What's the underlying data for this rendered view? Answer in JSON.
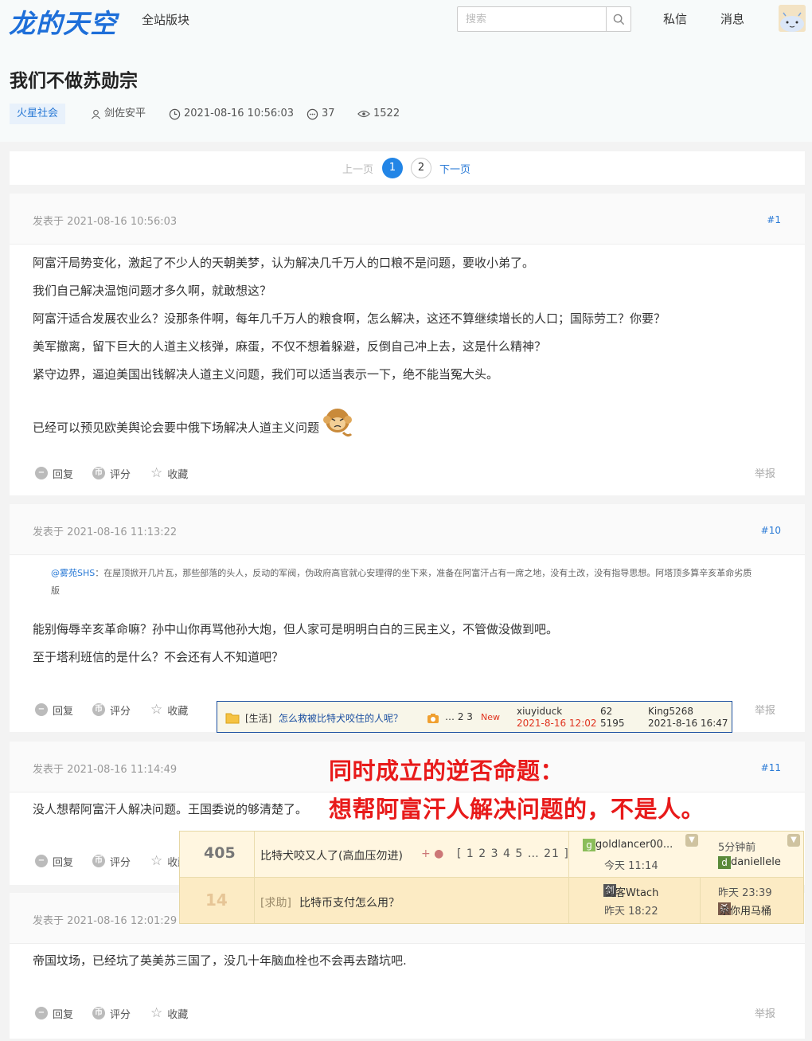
{
  "header": {
    "logo_text": "龙的天空",
    "nav_all": "全站版块",
    "search_placeholder": "搜索",
    "pm_label": "私信",
    "msg_label": "消息"
  },
  "thread": {
    "title": "我们不做苏勋宗",
    "tag": "火星社会",
    "author": "剑佐安平",
    "datetime": "2021-08-16 10:56:03",
    "replies": "37",
    "views": "1522"
  },
  "pager": {
    "prev": "上一页",
    "pages": [
      "1",
      "2"
    ],
    "next": "下一页"
  },
  "actions": {
    "reply": "回复",
    "rate": "评分",
    "fav": "收藏",
    "report": "举报"
  },
  "posts": [
    {
      "time": "发表于 2021-08-16 10:56:03",
      "floor": "#1",
      "lines": [
        "阿富汗局势变化，激起了不少人的天朝美梦，认为解决几千万人的口粮不是问题，要收小弟了。",
        "我们自己解决温饱问题才多久啊，就敢想这？",
        "阿富汗适合发展农业么？没那条件啊，每年几千万人的粮食啊，怎么解决，这还不算继续增长的人口；国际劳工？你要？",
        "美军撤离，留下巨大的人道主义核弹，麻蛋，不仅不想着躲避，反倒自己冲上去，这是什么精神？",
        "紧守边界，逼迫美国出钱解决人道主义问题，我们可以适当表示一下，绝不能当冤大头。",
        "已经可以预见欧美舆论会要中俄下场解决人道主义问题"
      ]
    },
    {
      "time": "发表于 2021-08-16 11:13:22",
      "floor": "#10",
      "quote_name": "@雾苑SHS",
      "quote_text": "：在屋顶掀开几片瓦，那些部落的头人，反动的军阀，伪政府高官就心安理得的坐下来，准备在阿富汗占有一席之地，没有土改，没有指导思想。阿塔顶多算辛亥革命劣质版",
      "lines": [
        "能别侮辱辛亥革命嘛？孙中山你再骂他孙大炮，但人家可是明明白白的三民主义，不管做没做到吧。",
        "至于塔利班信的是什么？不会还有人不知道吧？"
      ]
    },
    {
      "time": "发表于 2021-08-16 11:14:49",
      "floor": "#11",
      "lines": [
        "没人想帮阿富汗人解决问题。王国委说的够清楚了。"
      ]
    },
    {
      "time": "发表于 2021-08-16 12:01:29",
      "floor": "",
      "lines": [
        "帝国坟场，已经坑了英美苏三国了，没几十年脑血栓也不会再去踏坑吧."
      ]
    }
  ],
  "overlay_forum_row": {
    "category": "[生活]",
    "title": "怎么救被比特犬咬住的人呢？",
    "pages": "… 2  3",
    "new_badge": "New",
    "author": "xiuyiduck",
    "author_date": "2021-8-16 12:02",
    "replies": "62",
    "views": "5195",
    "last_user": "King5268",
    "last_date": "2021-8-16 16:47"
  },
  "overlay_text": {
    "line1": "同时成立的逆否命题：",
    "line2": "想帮阿富汗人解决问题的，不是人。"
  },
  "overlay_list": [
    {
      "count": "405",
      "title": "比特犬咬又人了(高血压勿进)",
      "pages": "[ 1 2 3 4 5 … 21 ]",
      "author": "goldlancer00...",
      "author_time": "今天 11:14",
      "last_time": "5分钟前",
      "last_user": "daniellele"
    },
    {
      "count": "14",
      "category": "[求助]",
      "title": "比特币支付怎么用？",
      "author": "剑客Wtach",
      "author_time": "昨天 18:22",
      "last_time": "昨天 23:39",
      "last_user": "杀你用马桶"
    }
  ]
}
